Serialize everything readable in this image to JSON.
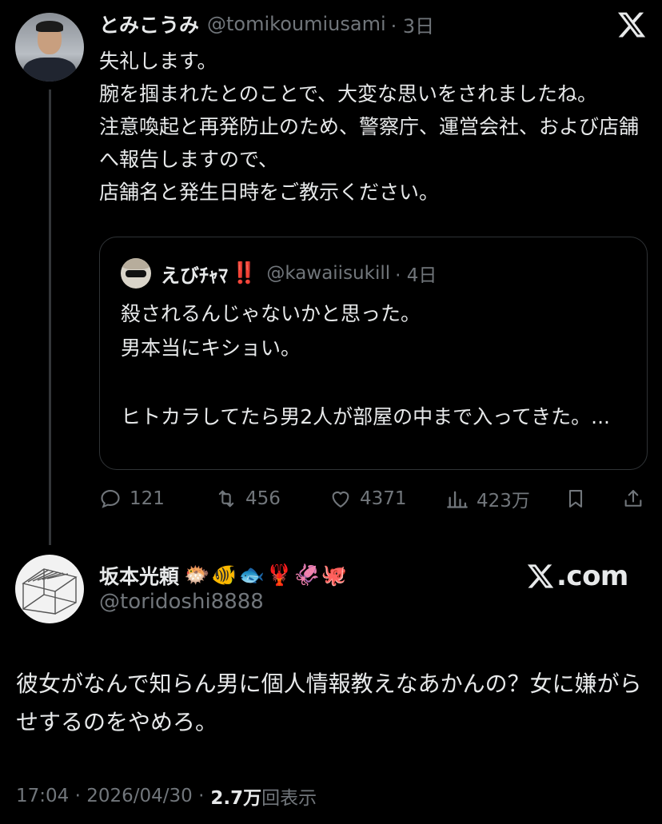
{
  "tweet1": {
    "name": "とみこうみ",
    "handle": "@tomikoumiusami",
    "time": "· 3日",
    "text": "失礼します。\n腕を掴まれたとのことで、大変な思いをされましたね。\n注意喚起と再発防止のため、警察庁、運営会社、および店舗へ報告しますので、\n店舗名と発生日時をご教示ください。"
  },
  "quote": {
    "name": "えびﾁｬﾏ",
    "name_emoji": "‼️",
    "handle": "@kawaiisukill",
    "time": "· 4日",
    "text": "殺されるんじゃないかと思った。\n男本当にキショい。\n\nヒトカラしてたら男2人が部屋の中まで入ってきた。..."
  },
  "actions": {
    "replies": "121",
    "retweets": "456",
    "likes": "4371",
    "views": "423万"
  },
  "tweet2": {
    "name": "坂本光頼",
    "emojis": "🐡🐠🐟🦞🦑🐙",
    "handle": "@toridoshi8888",
    "source_label": ".com",
    "text": "彼女がなんで知らん男に個人情報教えなあかんの？女に嫌がらせするのをやめろ。",
    "timestamp": "17:04 · 2026/04/30 ·",
    "views_count": "2.7万",
    "views_label": "回表示"
  },
  "icons": [
    "x-logo-icon",
    "reply-icon",
    "retweet-icon",
    "like-icon",
    "views-icon",
    "bookmark-icon",
    "share-icon"
  ],
  "colors": {
    "background": "#000000",
    "text": "#e7e9ea",
    "secondary": "#71767b",
    "border": "#2f3336"
  }
}
